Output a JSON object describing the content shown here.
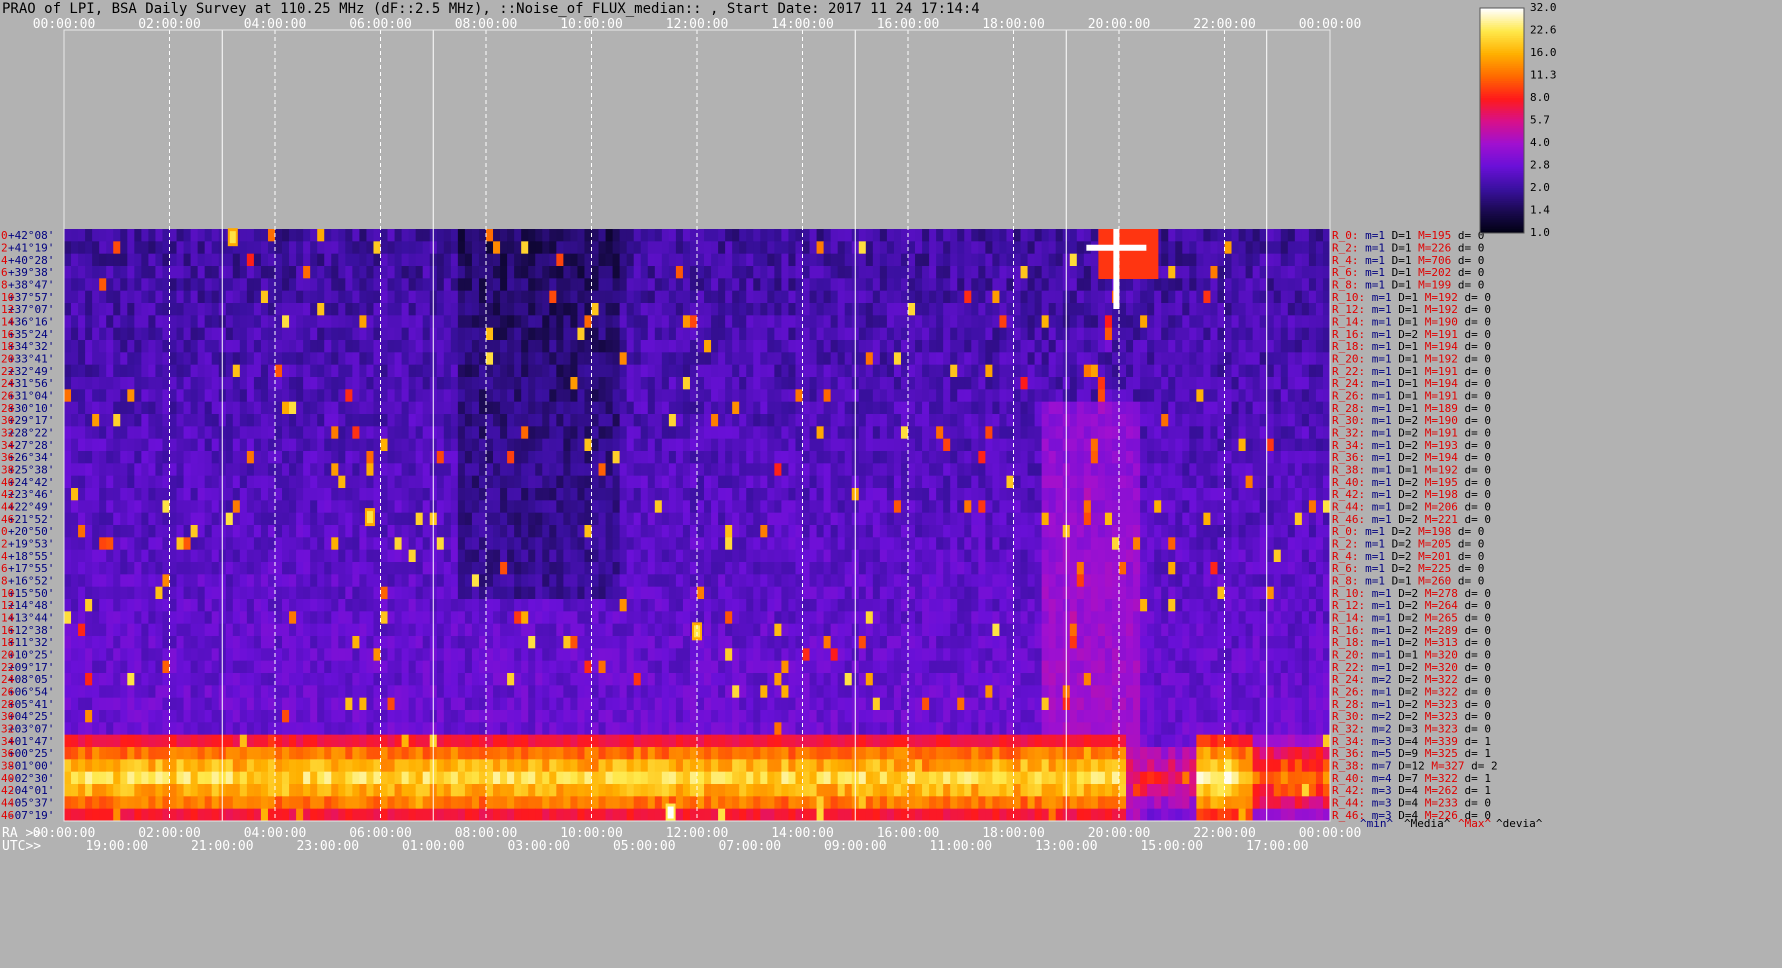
{
  "title": "PRAO of LPI, BSA Daily Survey at 110.25 MHz (dF::2.5 MHz), ::Noise_of_FLUX_median:: , Start Date: 2017 11 24 17:14:4",
  "chart_data": {
    "type": "heatmap",
    "top_time_ticks": [
      "00:00:00",
      "02:00:00",
      "04:00:00",
      "06:00:00",
      "08:00:00",
      "10:00:00",
      "12:00:00",
      "14:00:00",
      "16:00:00",
      "18:00:00",
      "20:00:00",
      "22:00:00",
      "00:00:00"
    ],
    "ra_label": "RA >>",
    "ra_ticks": [
      "00:00:00",
      "02:00:00",
      "04:00:00",
      "06:00:00",
      "08:00:00",
      "10:00:00",
      "12:00:00",
      "14:00:00",
      "16:00:00",
      "18:00:00",
      "20:00:00",
      "22:00:00",
      "00:00:00"
    ],
    "utc_label": "UTC>>",
    "utc_ticks": [
      "19:0",
      "21:0",
      "23:0",
      "01:0",
      "03:0",
      "05:0",
      "07:0",
      "09:0",
      "11:0",
      "13:0",
      "15:0",
      "17:0"
    ],
    "utc_tick_suffix": "0:00",
    "dec_ticks": [
      "+42°08'",
      "+41°19'",
      "+40°28'",
      "+39°38'",
      "+38°47'",
      "+37°57'",
      "+37°07'",
      "+36°16'",
      "+35°24'",
      "+34°32'",
      "+33°41'",
      "+32°49'",
      "+31°56'",
      "+31°04'",
      "+30°10'",
      "+29°17'",
      "+28°22'",
      "+27°28'",
      "+26°34'",
      "+25°38'",
      "+24°42'",
      "+23°46'",
      "+22°49'",
      "+21°52'",
      "+20°50'",
      "+19°53'",
      "+18°55'",
      "+17°55'",
      "+16°52'",
      "+15°50'",
      "+14°48'",
      "+13°44'",
      "+12°38'",
      "+11°32'",
      "+10°25'",
      "+09°17'",
      "+08°05'",
      "+06°54'",
      "+05°41'",
      "+04°25'",
      "+03°07'",
      "+01°47'",
      "+00°25'",
      "-01°00'",
      "-02°30'",
      "-04°01'",
      "-05°37'",
      "-07°19'"
    ],
    "beam_numbers": [
      "0",
      "2",
      "4",
      "6",
      "8",
      "10",
      "12",
      "14",
      "16",
      "18",
      "20",
      "22",
      "24",
      "26",
      "28",
      "30",
      "32",
      "34",
      "36",
      "38",
      "40",
      "42",
      "44",
      "46",
      "0",
      "2",
      "4",
      "6",
      "8",
      "10",
      "12",
      "14",
      "16",
      "18",
      "20",
      "22",
      "24",
      "26",
      "28",
      "30",
      "32",
      "34",
      "36",
      "38",
      "40",
      "42",
      "44",
      "46"
    ],
    "right_stats": [
      {
        "R": "R_0:",
        "m": "m=1",
        "D": "D=1",
        "M": "M=195",
        "d": "d= 0"
      },
      {
        "R": "R_2:",
        "m": "m=1",
        "D": "D=1",
        "M": "M=226",
        "d": "d= 0"
      },
      {
        "R": "R_4:",
        "m": "m=1",
        "D": "D=1",
        "M": "M=706",
        "d": "d= 0"
      },
      {
        "R": "R_6:",
        "m": "m=1",
        "D": "D=1",
        "M": "M=202",
        "d": "d= 0"
      },
      {
        "R": "R_8:",
        "m": "m=1",
        "D": "D=1",
        "M": "M=199",
        "d": "d= 0"
      },
      {
        "R": "R_10:",
        "m": "m=1",
        "D": "D=1",
        "M": "M=192",
        "d": "d= 0"
      },
      {
        "R": "R_12:",
        "m": "m=1",
        "D": "D=1",
        "M": "M=192",
        "d": "d= 0"
      },
      {
        "R": "R_14:",
        "m": "m=1",
        "D": "D=1",
        "M": "M=190",
        "d": "d= 0"
      },
      {
        "R": "R_16:",
        "m": "m=1",
        "D": "D=2",
        "M": "M=191",
        "d": "d= 0"
      },
      {
        "R": "R_18:",
        "m": "m=1",
        "D": "D=1",
        "M": "M=194",
        "d": "d= 0"
      },
      {
        "R": "R_20:",
        "m": "m=1",
        "D": "D=1",
        "M": "M=192",
        "d": "d= 0"
      },
      {
        "R": "R_22:",
        "m": "m=1",
        "D": "D=1",
        "M": "M=191",
        "d": "d= 0"
      },
      {
        "R": "R_24:",
        "m": "m=1",
        "D": "D=1",
        "M": "M=194",
        "d": "d= 0"
      },
      {
        "R": "R_26:",
        "m": "m=1",
        "D": "D=1",
        "M": "M=191",
        "d": "d= 0"
      },
      {
        "R": "R_28:",
        "m": "m=1",
        "D": "D=1",
        "M": "M=189",
        "d": "d= 0"
      },
      {
        "R": "R_30:",
        "m": "m=1",
        "D": "D=2",
        "M": "M=190",
        "d": "d= 0"
      },
      {
        "R": "R_32:",
        "m": "m=1",
        "D": "D=2",
        "M": "M=191",
        "d": "d= 0"
      },
      {
        "R": "R_34:",
        "m": "m=1",
        "D": "D=2",
        "M": "M=193",
        "d": "d= 0"
      },
      {
        "R": "R_36:",
        "m": "m=1",
        "D": "D=2",
        "M": "M=194",
        "d": "d= 0"
      },
      {
        "R": "R_38:",
        "m": "m=1",
        "D": "D=1",
        "M": "M=192",
        "d": "d= 0"
      },
      {
        "R": "R_40:",
        "m": "m=1",
        "D": "D=2",
        "M": "M=195",
        "d": "d= 0"
      },
      {
        "R": "R_42:",
        "m": "m=1",
        "D": "D=2",
        "M": "M=198",
        "d": "d= 0"
      },
      {
        "R": "R_44:",
        "m": "m=1",
        "D": "D=2",
        "M": "M=206",
        "d": "d= 0"
      },
      {
        "R": "R_46:",
        "m": "m=1",
        "D": "D=2",
        "M": "M=221",
        "d": "d= 0"
      },
      {
        "R": "R_0:",
        "m": "m=1",
        "D": "D=2",
        "M": "M=198",
        "d": "d= 0"
      },
      {
        "R": "R_2:",
        "m": "m=1",
        "D": "D=2",
        "M": "M=205",
        "d": "d= 0"
      },
      {
        "R": "R_4:",
        "m": "m=1",
        "D": "D=2",
        "M": "M=201",
        "d": "d= 0"
      },
      {
        "R": "R_6:",
        "m": "m=1",
        "D": "D=2",
        "M": "M=225",
        "d": "d= 0"
      },
      {
        "R": "R_8:",
        "m": "m=1",
        "D": "D=1",
        "M": "M=260",
        "d": "d= 0"
      },
      {
        "R": "R_10:",
        "m": "m=1",
        "D": "D=2",
        "M": "M=278",
        "d": "d= 0"
      },
      {
        "R": "R_12:",
        "m": "m=1",
        "D": "D=2",
        "M": "M=264",
        "d": "d= 0"
      },
      {
        "R": "R_14:",
        "m": "m=1",
        "D": "D=2",
        "M": "M=265",
        "d": "d= 0"
      },
      {
        "R": "R_16:",
        "m": "m=1",
        "D": "D=2",
        "M": "M=289",
        "d": "d= 0"
      },
      {
        "R": "R_18:",
        "m": "m=1",
        "D": "D=2",
        "M": "M=313",
        "d": "d= 0"
      },
      {
        "R": "R_20:",
        "m": "m=1",
        "D": "D=1",
        "M": "M=320",
        "d": "d= 0"
      },
      {
        "R": "R_22:",
        "m": "m=1",
        "D": "D=2",
        "M": "M=320",
        "d": "d= 0"
      },
      {
        "R": "R_24:",
        "m": "m=2",
        "D": "D=2",
        "M": "M=322",
        "d": "d= 0"
      },
      {
        "R": "R_26:",
        "m": "m=1",
        "D": "D=2",
        "M": "M=322",
        "d": "d= 0"
      },
      {
        "R": "R_28:",
        "m": "m=1",
        "D": "D=2",
        "M": "M=323",
        "d": "d= 0"
      },
      {
        "R": "R_30:",
        "m": "m=2",
        "D": "D=2",
        "M": "M=323",
        "d": "d= 0"
      },
      {
        "R": "R_32:",
        "m": "m=2",
        "D": "D=3",
        "M": "M=323",
        "d": "d= 0"
      },
      {
        "R": "R_34:",
        "m": "m=3",
        "D": "D=4",
        "M": "M=339",
        "d": "d= 1"
      },
      {
        "R": "R_36:",
        "m": "m=5",
        "D": "D=9",
        "M": "M=325",
        "d": "d= 1"
      },
      {
        "R": "R_38:",
        "m": "m=7",
        "D": "D=12",
        "M": "M=327",
        "d": "d= 2"
      },
      {
        "R": "R_40:",
        "m": "m=4",
        "D": "D=7",
        "M": "M=322",
        "d": "d= 1"
      },
      {
        "R": "R_42:",
        "m": "m=3",
        "D": "D=4",
        "M": "M=262",
        "d": "d= 1"
      },
      {
        "R": "R_44:",
        "m": "m=3",
        "D": "D=4",
        "M": "M=233",
        "d": "d= 0"
      },
      {
        "R": "R_46:",
        "m": "m=3",
        "D": "D=4",
        "M": "M=226",
        "d": "d= 0"
      }
    ],
    "stat_headers": [
      "^min^",
      "^Media^",
      "^Max^",
      "^devia^"
    ],
    "colorbar_ticks": [
      "32.0",
      "22.6",
      "16.0",
      "11.3",
      "8.0",
      "5.7",
      "4.0",
      "2.8",
      "2.0",
      "1.4",
      "1.0"
    ],
    "colors": {
      "background": "#b2b2b2",
      "blue_text": "#00007f",
      "red_text": "#e00000",
      "colormap": [
        "#000010",
        "#1a0a50",
        "#3a10a0",
        "#6a10d8",
        "#a010d0",
        "#d8108a",
        "#ff1a1a",
        "#ff6a00",
        "#ffb000",
        "#ffe84a",
        "#ffffff"
      ]
    },
    "features": [
      {
        "name": "horizontal bright band",
        "dec_from": "+01°47'",
        "dec_to": "-07°19'",
        "ra_from_h": 0,
        "ra_to_h": 24,
        "level": 18
      },
      {
        "name": "sun-like source cross",
        "ra_h": 19.95,
        "dec_deg": 41.3,
        "level": 32
      },
      {
        "name": "diagonal streak",
        "ra_from_h": 18.9,
        "dec_from_deg": 1.8,
        "ra_to_h": 20.0,
        "dec_to_deg": 42.0,
        "level": 12
      },
      {
        "name": "bright spot",
        "ra_h": 12.0,
        "dec_deg": 12.5,
        "level": 22
      },
      {
        "name": "bright spot",
        "ra_h": 5.8,
        "dec_deg": 22.0,
        "level": 22
      },
      {
        "name": "bright spot",
        "ra_h": 3.2,
        "dec_deg": 42.0,
        "level": 22
      },
      {
        "name": "bright spot",
        "ra_h": 11.5,
        "dec_deg": -7.0,
        "level": 32
      }
    ]
  }
}
